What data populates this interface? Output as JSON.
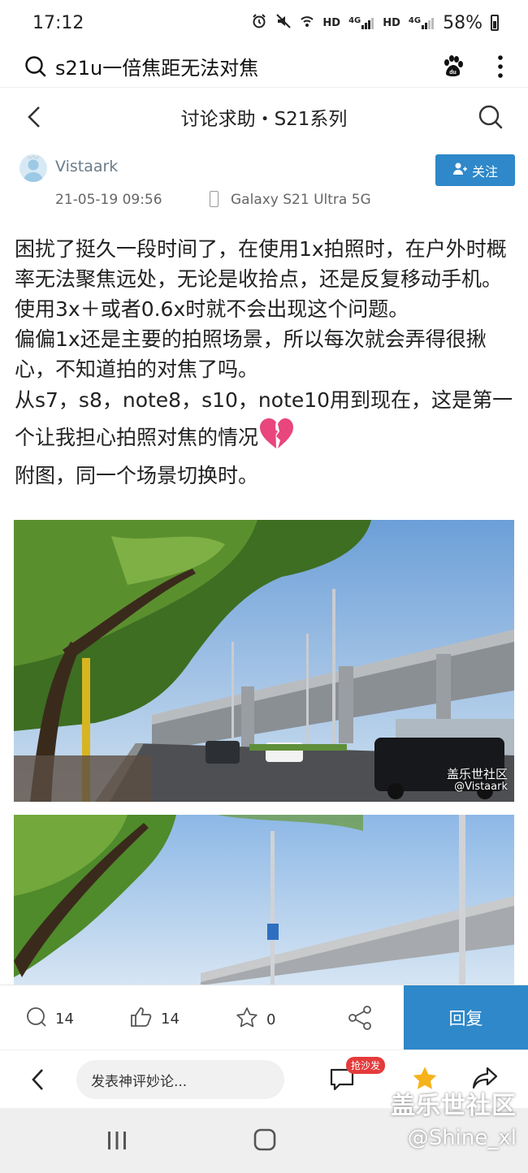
{
  "status": {
    "time": "17:12",
    "hd1": "HD",
    "net1": "4G",
    "hd2": "HD",
    "net2": "4G",
    "battery": "58%"
  },
  "search": {
    "query": "s21u一倍焦距无法对焦"
  },
  "nav": {
    "title": "讨论求助・S21系列"
  },
  "post": {
    "author": "Vistaark",
    "date": "21-05-19 09:56",
    "device": "Galaxy S21 Ultra 5G",
    "follow_label": "关注",
    "body_lines": [
      "困扰了挺久一段时间了，在使用1x拍照时，在户外时概率无法聚焦远处，无论是收拾点，还是反复移动手机。使用3x＋或者0.6x时就不会出现这个问题。",
      "偏偏1x还是主要的拍照场景，所以每次就会弄得很揪心，不知道拍的对焦了吗。",
      "从s7，s8，note8，s10，note10用到现在，这是第一个让我担心拍照对焦的情况",
      "附图，同一个场景切换时。"
    ],
    "photo_watermark_site": "盖乐世社区",
    "photo_watermark_user": "@Vistaark"
  },
  "actions": {
    "comments": "14",
    "likes": "14",
    "favorites": "0",
    "reply_label": "回复"
  },
  "comment_bar": {
    "placeholder": "发表神评妙论...",
    "sofa_badge": "抢沙发"
  },
  "watermark": {
    "site": "盖乐世社区",
    "user": "@Shine_xl"
  },
  "colors": {
    "accent": "#2f88c9",
    "badge": "#e43b3b",
    "star": "#f5b21b",
    "heart": "#e8467c"
  }
}
